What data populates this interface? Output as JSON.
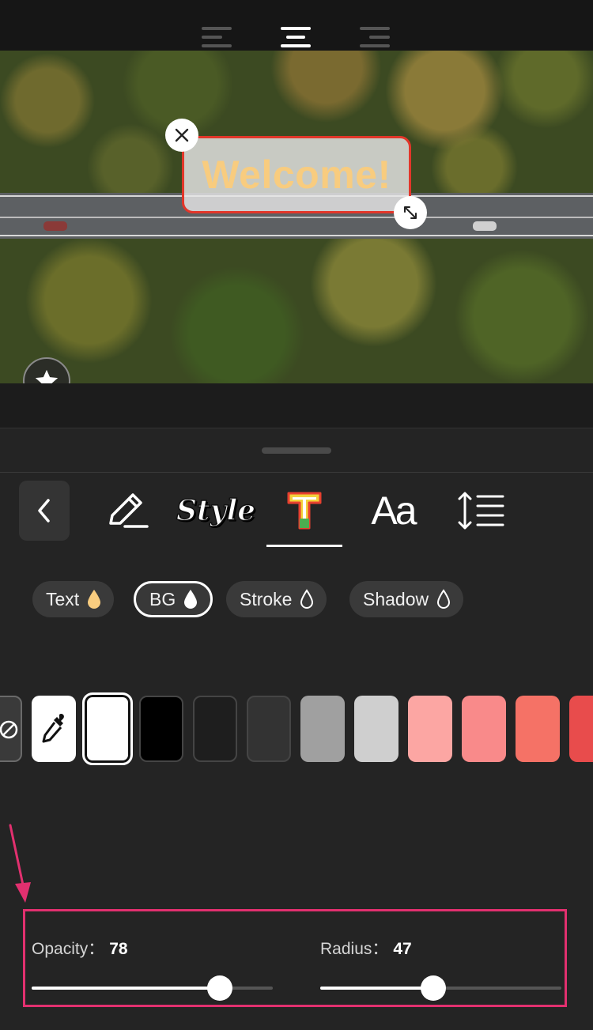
{
  "toolbar_align": {
    "options": [
      "align-left",
      "align-center",
      "align-right"
    ],
    "selected": "align-center"
  },
  "preview": {
    "overlay_text": "Welcome!",
    "overlay_text_color": "#F8CC7F",
    "overlay_border_color": "#E2362A"
  },
  "tools": {
    "back_icon": "chevron-left-icon",
    "items": [
      "edit-icon",
      "style-icon",
      "text-color-icon",
      "font-icon",
      "line-spacing-icon"
    ],
    "style_label": "Style",
    "font_label": "Aa",
    "selected": "text-color-icon"
  },
  "color_targets": {
    "text": "Text",
    "bg": "BG",
    "stroke": "Stroke",
    "shadow": "Shadow",
    "selected": "BG",
    "text_drop_color": "#F8CC7F"
  },
  "swatches": {
    "selected_index": 0,
    "colors": [
      "#FFFFFF",
      "#000000",
      "#1E1E1E",
      "#333333",
      "#A0A0A0",
      "#CFCFCF",
      "#FCA6A3",
      "#F98A8A",
      "#F57266",
      "#E84C4C"
    ]
  },
  "sliders": {
    "opacity_label": "Opacity：",
    "opacity_value": "78",
    "opacity_fraction": 0.78,
    "radius_label": "Radius：",
    "radius_value": "47",
    "radius_fraction": 0.47
  },
  "annotation_color": "#E2306F"
}
